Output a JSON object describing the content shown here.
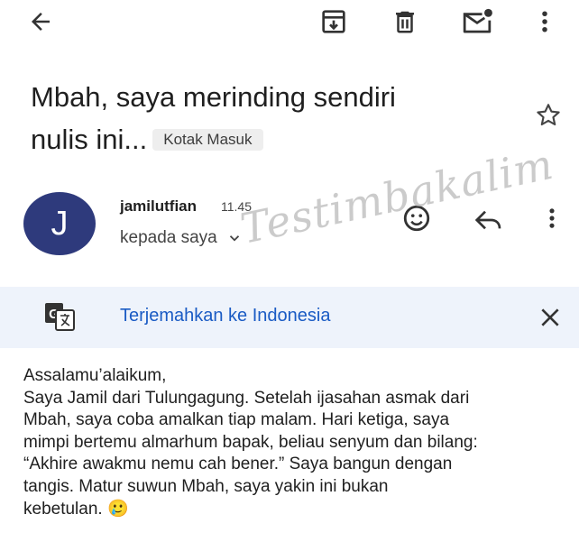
{
  "toolbar": {
    "back_icon": "arrow-back-icon",
    "archive_icon": "archive-icon",
    "delete_icon": "trash-icon",
    "mark_unread_icon": "mail-unread-icon",
    "more_icon": "more-vert-icon"
  },
  "email": {
    "subject": "Mbah, saya merinding sendiri nulis ini...",
    "subject_line1": "Mbah, saya merinding sendiri",
    "subject_line2": "nulis ini...",
    "label": "Kotak Masuk",
    "sender_initial": "J",
    "sender": "jamilutfian",
    "time": "11.45",
    "recipient": "kepada saya",
    "body_lines": [
      "Assalamu’alaikum,",
      "Saya Jamil dari Tulungagung. Setelah ijasahan asmak dari",
      "Mbah, saya coba amalkan tiap malam. Hari ketiga, saya",
      "mimpi bertemu almarhum bapak, beliau senyum dan bilang:",
      "“Akhire awakmu nemu cah bener.” Saya bangun dengan",
      "tangis. Matur suwun Mbah, saya yakin ini bukan",
      "kebetulan. 🥲"
    ]
  },
  "translate": {
    "link": "Terjemahkan ke Indonesia"
  },
  "watermark": "Testimbakalim",
  "colors": {
    "avatar": "#2e3a7c",
    "translate_bar": "#eef3fb",
    "link": "#1a5bc4"
  }
}
